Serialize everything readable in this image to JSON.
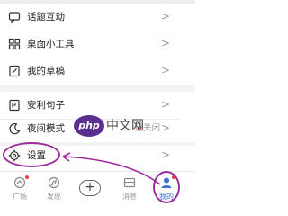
{
  "menu": {
    "items": [
      {
        "label": "话题互动",
        "icon": "chat-bubble-icon"
      },
      {
        "label": "桌面小工具",
        "icon": "widget-icon"
      },
      {
        "label": "我的草稿",
        "icon": "draft-icon"
      },
      {
        "label": "安利句子",
        "icon": "quote-icon"
      },
      {
        "label": "夜间模式",
        "icon": "moon-icon",
        "value": "已关闭"
      },
      {
        "label": "设置",
        "icon": "gear-icon"
      }
    ],
    "chevron": ">"
  },
  "watermark": {
    "logo": "php",
    "text": "中文网"
  },
  "bottom_nav": {
    "items": [
      {
        "label": "广场",
        "icon": "plaza-icon"
      },
      {
        "label": "发现",
        "icon": "discover-icon"
      },
      {
        "label": "消息",
        "icon": "message-icon"
      },
      {
        "label": "我的",
        "icon": "person-icon"
      }
    ],
    "post_symbol": "+"
  },
  "colors": {
    "annotation": "#9c2b9e",
    "badge": "#e8414d",
    "active_tab": "#3b6fd6"
  }
}
